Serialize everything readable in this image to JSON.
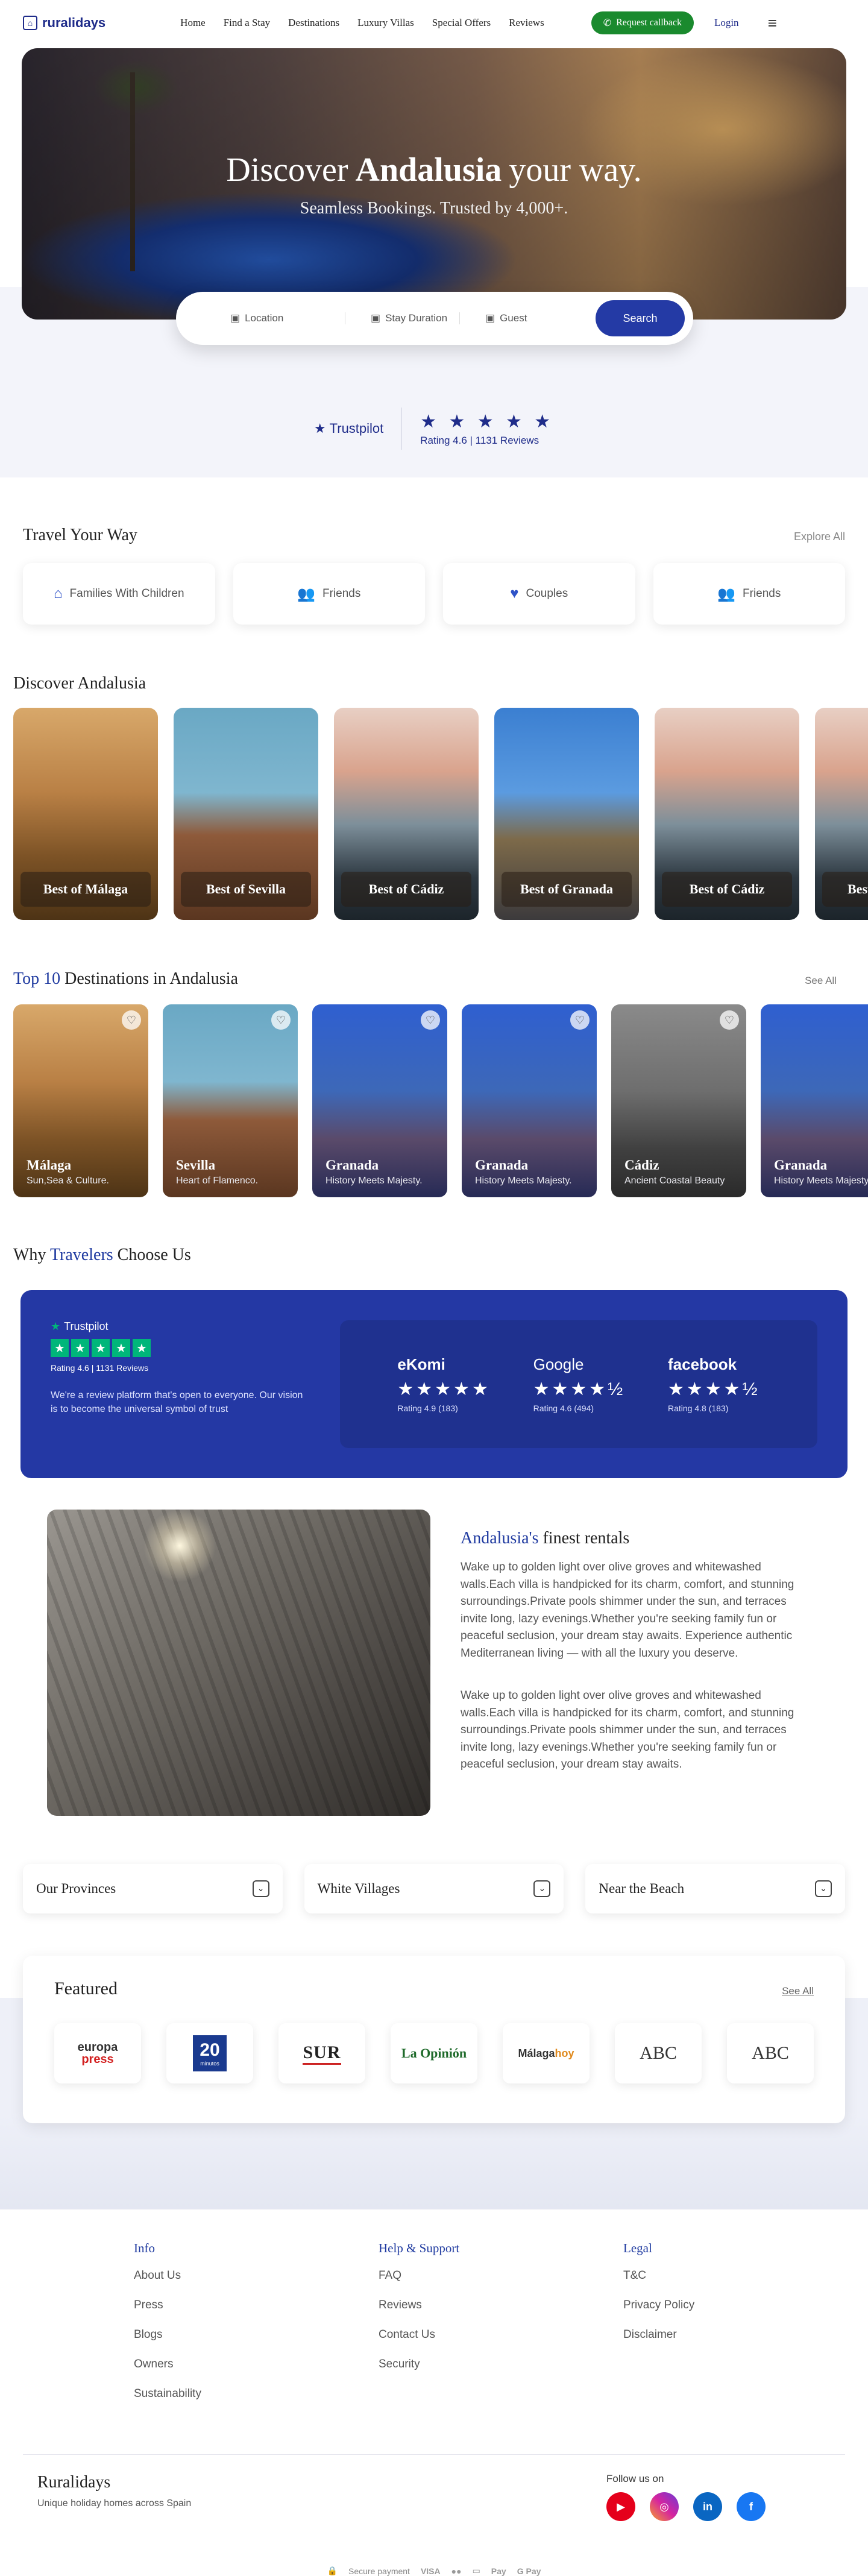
{
  "nav": {
    "logo": "ruralidays",
    "links": [
      "Home",
      "Find a Stay",
      "Destinations",
      "Luxury Villas",
      "Special Offers",
      "Reviews"
    ],
    "callback": "Request callback",
    "login": "Login"
  },
  "hero": {
    "title_pre": "Discover",
    "title_bold": "Andalusia",
    "title_post": "your way.",
    "subtitle": "Seamless Bookings. Trusted by 4,000+.",
    "fields": [
      "Location",
      "Stay Duration",
      "Guest"
    ],
    "search": "Search"
  },
  "trustpilot": {
    "name": "Trustpilot",
    "stars": "★ ★ ★ ★ ★",
    "rating": "Rating 4.6 | 1131 Reviews"
  },
  "travel": {
    "title": "Travel Your Way",
    "explore": "Explore All",
    "cards": [
      "Families With Children",
      "Friends",
      "Couples",
      "Friends"
    ]
  },
  "discover": {
    "title": "Discover Andalusia",
    "cards": [
      "Best of Málaga",
      "Best of Sevilla",
      "Best of Cádiz",
      "Best of Granada",
      "Best of Cádiz",
      "Best of Sevilla"
    ]
  },
  "top10": {
    "title_accent": "Top 10",
    "title_rest": "Destinations in Andalusia",
    "see_all": "See All",
    "cards": [
      {
        "name": "Málaga",
        "sub": "Sun,Sea & Culture."
      },
      {
        "name": "Sevilla",
        "sub": "Heart of Flamenco."
      },
      {
        "name": "Granada",
        "sub": "History Meets Majesty."
      },
      {
        "name": "Granada",
        "sub": "History Meets Majesty."
      },
      {
        "name": "Cádiz",
        "sub": "Ancient Coastal Beauty"
      },
      {
        "name": "Granada",
        "sub": "History Meets Majesty."
      }
    ]
  },
  "why": {
    "title_pre": "Why",
    "title_accent": "Travelers",
    "title_post": "Choose Us",
    "tp_name": "Trustpilot",
    "tp_rating": "Rating 4.6 | 1131 Reviews",
    "text": "We're a review platform that's open to everyone. Our vision is to become the universal symbol of trust",
    "reviews": [
      {
        "brand": "eKomi",
        "stars": "★★★★★",
        "rating": "Rating 4.9 (183)"
      },
      {
        "brand": "Google",
        "stars": "★★★★½",
        "rating": "Rating 4.6 (494)"
      },
      {
        "brand": "facebook",
        "stars": "★★★★½",
        "rating": "Rating 4.8 (183)"
      }
    ]
  },
  "rentals": {
    "title_accent": "Andalusia's",
    "title_rest": "finest rentals",
    "p1": "Wake up to golden light over olive groves and whitewashed walls.Each villa is handpicked for its charm, comfort, and stunning surroundings.Private pools shimmer under the sun, and terraces invite long, lazy evenings.Whether you're seeking family fun or peaceful seclusion, your dream stay awaits. Experience authentic Mediterranean living — with all the luxury you deserve.",
    "p2": "Wake up to golden light over olive groves and whitewashed walls.Each villa is handpicked for its charm, comfort, and stunning surroundings.Private pools shimmer under the sun, and terraces invite long, lazy evenings.Whether you're seeking family fun or peaceful seclusion, your dream stay awaits."
  },
  "accordions": [
    "Our Provinces",
    "White Villages",
    "Near the Beach"
  ],
  "featured": {
    "title": "Featured",
    "see_all": "See All",
    "logos": [
      "europa",
      "press",
      "20",
      "minutos",
      "SUR",
      "La Opinión",
      "Málaga",
      "hoy",
      "ABC",
      "ABC"
    ]
  },
  "footer": {
    "info_title": "Info",
    "info": [
      "About Us",
      "Press",
      "Blogs",
      "Owners",
      "Sustainability"
    ],
    "help_title": "Help & Support",
    "help": [
      "FAQ",
      "Reviews",
      "Contact Us",
      "Security"
    ],
    "legal_title": "Legal",
    "legal": [
      "T&C",
      "Privacy Policy",
      "Disclaimer"
    ],
    "brand": "Ruralidays",
    "tagline": "Unique holiday homes across Spain",
    "follow": "Follow us on",
    "secure": "Secure payment",
    "payments": [
      "VISA",
      "●●",
      "▭",
      "Pay",
      "G Pay"
    ]
  },
  "colors": {
    "brand": "#1f2c8a",
    "accent": "#2438a4",
    "callback": "#1a8a2e",
    "trustpilot_green": "#00b67a"
  }
}
